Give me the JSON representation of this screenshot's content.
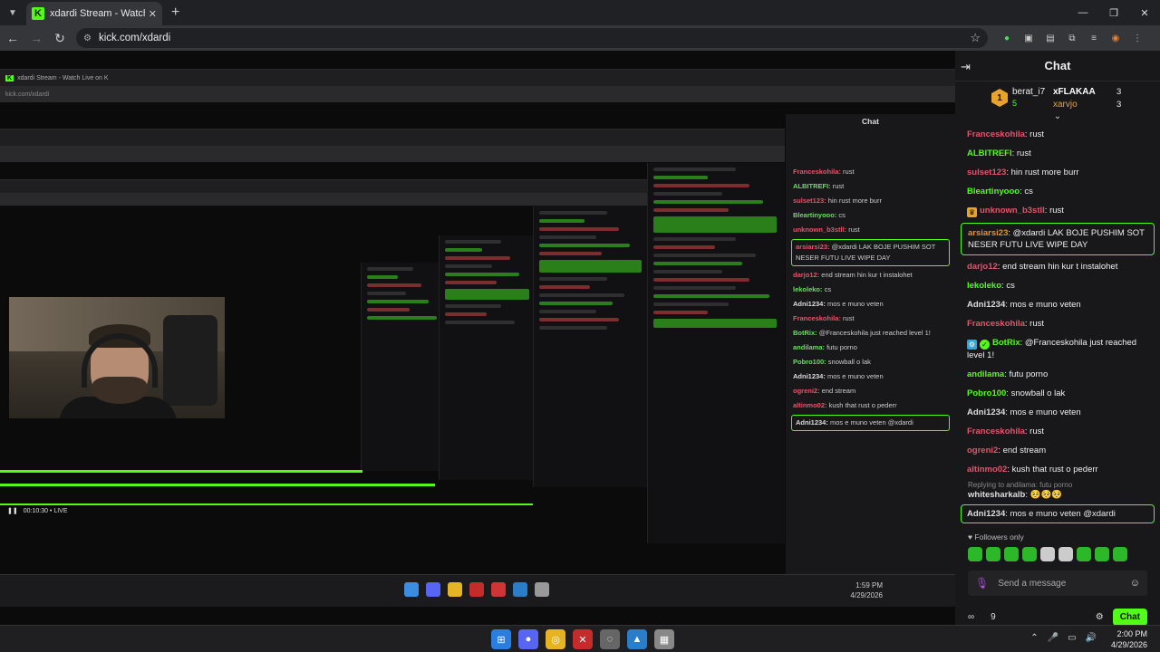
{
  "browser": {
    "tab_title": "xdardi Stream - Watch Live on K",
    "url": "kick.com/xdardi"
  },
  "stream": {
    "nested_tab_title": "xdardi Stream - Watch Live on K",
    "nested_url": "kick.com/xdardi",
    "nested_chat_title": "Chat",
    "nested_clock_time": "1:59 PM",
    "nested_clock_date": "4/29/2026",
    "live_time": "00:10:30",
    "live_label": "LIVE"
  },
  "chat": {
    "title": "Chat",
    "leaderboard": {
      "first": {
        "rank": "1",
        "name": "berat_i7",
        "count": "5"
      },
      "second": {
        "name": "xFLAKAA",
        "count": "3"
      },
      "third": {
        "name": "xarvjo",
        "count": "3"
      }
    },
    "messages": [
      {
        "user": "Franceskohila",
        "text": "rust",
        "color": "red",
        "badge": ""
      },
      {
        "user": "ALBITREFI",
        "text": "rust",
        "color": "green",
        "badge": ""
      },
      {
        "user": "sulset123",
        "text": "hin rust more burr",
        "color": "red",
        "badge": ""
      },
      {
        "user": "Bleartinyooo",
        "text": "cs",
        "color": "green",
        "badge": ""
      },
      {
        "user": "unknown_b3stll",
        "text": "rust",
        "color": "red",
        "badge": "crown"
      },
      {
        "user": "arsiarsi23",
        "text": "@xdardi LAK BOJE PUSHIM SOT NESER FUTU LIVE WIPE DAY",
        "color": "orange",
        "badge": "",
        "highlight": true
      },
      {
        "user": "darjo12",
        "text": "end stream hin kur t instalohet",
        "color": "red",
        "badge": ""
      },
      {
        "user": "lekoleko",
        "text": "cs",
        "color": "green",
        "badge": ""
      },
      {
        "user": "Adni1234",
        "text": "mos e muno veten",
        "color": "gray",
        "badge": ""
      },
      {
        "user": "Franceskohila",
        "text": "rust",
        "color": "red",
        "badge": ""
      },
      {
        "user": "BotRix",
        "text": "@Franceskohila just reached level 1!",
        "color": "green",
        "badge": "bot"
      },
      {
        "user": "andilama",
        "text": "futu porno",
        "color": "green",
        "badge": ""
      },
      {
        "user": "Pobro100",
        "text": "snowball o lak",
        "color": "green",
        "badge": ""
      },
      {
        "user": "Adni1234",
        "text": "mos e muno veten",
        "color": "gray",
        "badge": ""
      },
      {
        "user": "Franceskohila",
        "text": "rust",
        "color": "red",
        "badge": ""
      },
      {
        "user": "ogreni2",
        "text": "end stream",
        "color": "red",
        "badge": ""
      },
      {
        "user": "altinmo02",
        "text": "kush that rust o pederr",
        "color": "red",
        "badge": ""
      }
    ],
    "reply_hint": "Replying to andilama: futu porno",
    "reply_user": "whitesharkalb",
    "reply_emojis": "🥺🥺🥺",
    "reply_message_user": "Adni1234",
    "reply_message_text": "mos e muno veten @xdardi",
    "followers_only": "Followers only",
    "input_placeholder": "Send a message",
    "footer_points": "9",
    "send_label": "Chat"
  },
  "taskbar": {
    "time": "2:00 PM",
    "date": "4/29/2026"
  },
  "colors": {
    "kick_green": "#53fc18",
    "chat_bg": "#18181b",
    "chrome_bg": "#202124"
  },
  "icons": [
    "tab-list-icon",
    "kick-favicon",
    "close-icon",
    "new-tab-icon",
    "minimize-icon",
    "maximize-icon",
    "back-icon",
    "forward-icon",
    "reload-icon",
    "site-info-icon",
    "star-icon",
    "extension-icon",
    "collapse-chat-icon",
    "crown-icon",
    "bot-icon",
    "mic-icon",
    "emoji-icon",
    "gear-icon",
    "windows-start-icon"
  ]
}
